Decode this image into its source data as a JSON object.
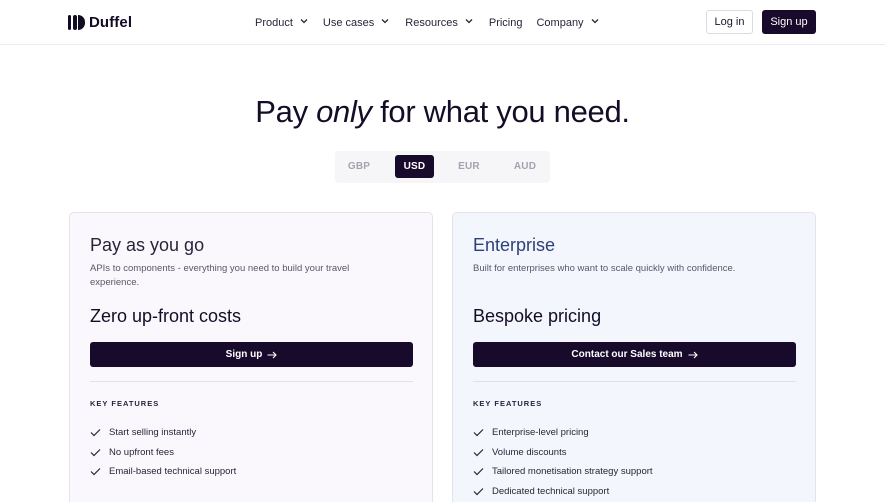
{
  "nav": {
    "logo_text": "Duffel",
    "menu": [
      {
        "label": "Product",
        "has_dropdown": true
      },
      {
        "label": "Use cases",
        "has_dropdown": true
      },
      {
        "label": "Resources",
        "has_dropdown": true
      },
      {
        "label": "Pricing",
        "has_dropdown": false
      },
      {
        "label": "Company",
        "has_dropdown": true
      }
    ],
    "login_label": "Log in",
    "signup_label": "Sign up"
  },
  "hero": {
    "title_before": "Pay ",
    "title_emphasis": "only",
    "title_after": " for what you need."
  },
  "currency": {
    "options": [
      "GBP",
      "USD",
      "EUR",
      "AUD"
    ],
    "selected": "USD"
  },
  "plans": [
    {
      "title": "Pay as you go",
      "description": "APIs to components - everything you need to build your travel experience.",
      "price": "Zero up-front costs",
      "cta_label": "Sign up",
      "features_heading": "KEY FEATURES",
      "features": [
        "Start selling instantly",
        "No upfront fees",
        "Email-based technical support"
      ]
    },
    {
      "title": "Enterprise",
      "description": "Built for enterprises who want to scale quickly with confidence.",
      "price": "Bespoke pricing",
      "cta_label": "Contact our Sales team",
      "features_heading": "KEY FEATURES",
      "features": [
        "Enterprise-level pricing",
        "Volume discounts",
        "Tailored monetisation strategy support",
        "Dedicated technical support"
      ]
    }
  ],
  "icons": {
    "logo": "duffel-logo-icon",
    "dropdown": "chevron-down-icon",
    "cta": "arrow-right-icon",
    "feature": "check-icon"
  },
  "colors": {
    "brand_dark": "#180a2b",
    "enterprise_title": "#2e3f7a",
    "left_card_bg": "#faf8fd",
    "right_card_bg": "#f3f6fc"
  }
}
